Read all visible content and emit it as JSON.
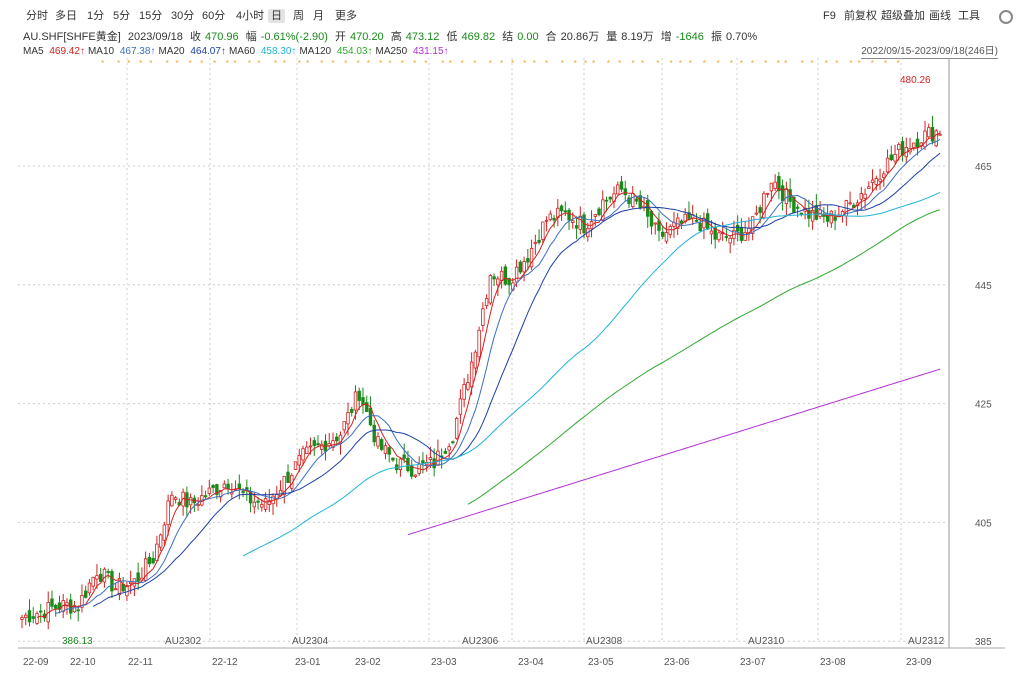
{
  "toolbar": {
    "periods": [
      "分时",
      "多日",
      "1分",
      "5分",
      "15分",
      "30分",
      "60分",
      "4小时",
      "日",
      "周",
      "月",
      "更多"
    ],
    "active": "日",
    "right": [
      "F9",
      "前复权",
      "超级叠加",
      "画线",
      "工具"
    ],
    "settings_icon": "gear-icon"
  },
  "quote": {
    "symbol": "AU.SHF[SHFE黄金]",
    "date": "2023/09/18",
    "close_label": "收",
    "close": "470.96",
    "change_label": "幅",
    "change": "-0.61%(-2.90)",
    "open_label": "开",
    "open": "470.20",
    "high_label": "高",
    "high": "473.12",
    "low_label": "低",
    "low": "469.82",
    "settle_label": "结",
    "settle": "0.00",
    "amount_label": "合",
    "amount": "20.86万",
    "volume_label": "量",
    "volume": "8.19万",
    "oi_change_label": "增",
    "oi_change": "-1646",
    "amplitude_label": "振",
    "amplitude": "0.70%"
  },
  "ma_legend": [
    {
      "name": "MA5",
      "value": "469.42↑",
      "color": "#d42020"
    },
    {
      "name": "MA10",
      "value": "467.38↑",
      "color": "#3a6fc2"
    },
    {
      "name": "MA20",
      "value": "464.07↑",
      "color": "#1b3fa8"
    },
    {
      "name": "MA60",
      "value": "458.30↑",
      "color": "#1eb4d6"
    },
    {
      "name": "MA120",
      "value": "454.03↑",
      "color": "#2fa82f"
    },
    {
      "name": "MA250",
      "value": "431.15↑",
      "color": "#b42fd6"
    }
  ],
  "range_text": "2022/09/15-2023/09/18(246日)",
  "colors": {
    "up": "#d42020",
    "down": "#1a8a1a",
    "grid": "#cccccc",
    "marker": "#f0a020"
  },
  "chart_data": {
    "type": "candlestick",
    "y_ticks": [
      385,
      405,
      425,
      445,
      465
    ],
    "ylim": [
      383.2,
      487.9
    ],
    "x_ticks": [
      "22-09",
      "22-10",
      "22-11",
      "22-12",
      "23-01",
      "23-02",
      "23-03",
      "23-04",
      "23-05",
      "23-06",
      "23-07",
      "23-08",
      "23-09"
    ],
    "contract_labels": [
      "AU2302",
      "AU2304",
      "AU2306",
      "AU2308",
      "AU2310",
      "AU2312"
    ],
    "annotations": [
      {
        "text": "480.26",
        "kind": "high"
      },
      {
        "text": "386.13",
        "kind": "low"
      }
    ],
    "anchors": [
      {
        "m": "22-09",
        "v": [
          389,
          390,
          391
        ]
      },
      {
        "m": "22-10",
        "v": [
          391,
          397,
          394
        ]
      },
      {
        "m": "22-11",
        "v": [
          395,
          399,
          410,
          408
        ]
      },
      {
        "m": "22-12",
        "v": [
          410,
          412,
          409
        ]
      },
      {
        "m": "23-01",
        "v": [
          408,
          412,
          416,
          418
        ]
      },
      {
        "m": "23-02",
        "v": [
          420,
          427,
          418,
          415
        ]
      },
      {
        "m": "23-03",
        "v": [
          414,
          415,
          420,
          432,
          447
        ]
      },
      {
        "m": "23-04",
        "v": [
          446,
          450,
          456,
          457
        ]
      },
      {
        "m": "23-05",
        "v": [
          455,
          459,
          461,
          458
        ]
      },
      {
        "m": "23-06",
        "v": [
          453,
          455,
          456,
          453
        ]
      },
      {
        "m": "23-07",
        "v": [
          453,
          455,
          463,
          459
        ]
      },
      {
        "m": "23-08",
        "v": [
          457,
          456,
          458,
          461
        ]
      },
      {
        "m": "23-09",
        "v": [
          465,
          468,
          470,
          471
        ]
      }
    ]
  }
}
